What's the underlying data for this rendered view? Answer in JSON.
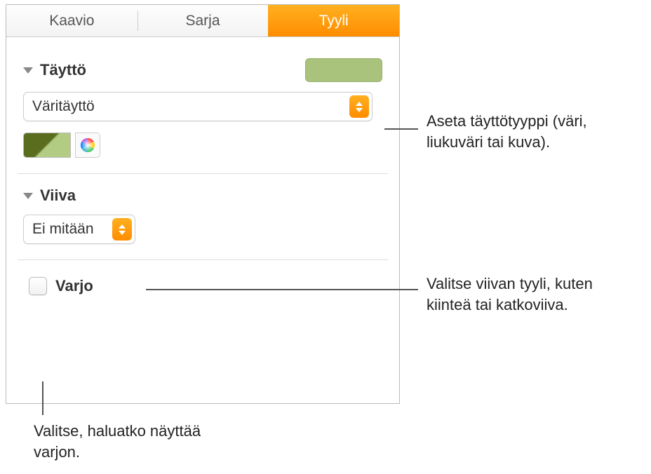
{
  "tabs": {
    "chart": "Kaavio",
    "series": "Sarja",
    "style": "Tyyli"
  },
  "fill": {
    "title": "Täyttö",
    "select_value": "Väritäyttö",
    "swatch_color": "#a9c37c",
    "gradient_dark": "#5a6d1f",
    "gradient_light": "#b3cc84"
  },
  "line": {
    "title": "Viiva",
    "select_value": "Ei mitään"
  },
  "shadow": {
    "label": "Varjo"
  },
  "callouts": {
    "fill": "Aseta täyttötyyppi (väri, liukuväri tai kuva).",
    "line": "Valitse viivan tyyli, kuten kiinteä tai katkoviiva.",
    "shadow": "Valitse, haluatko näyttää varjon."
  }
}
